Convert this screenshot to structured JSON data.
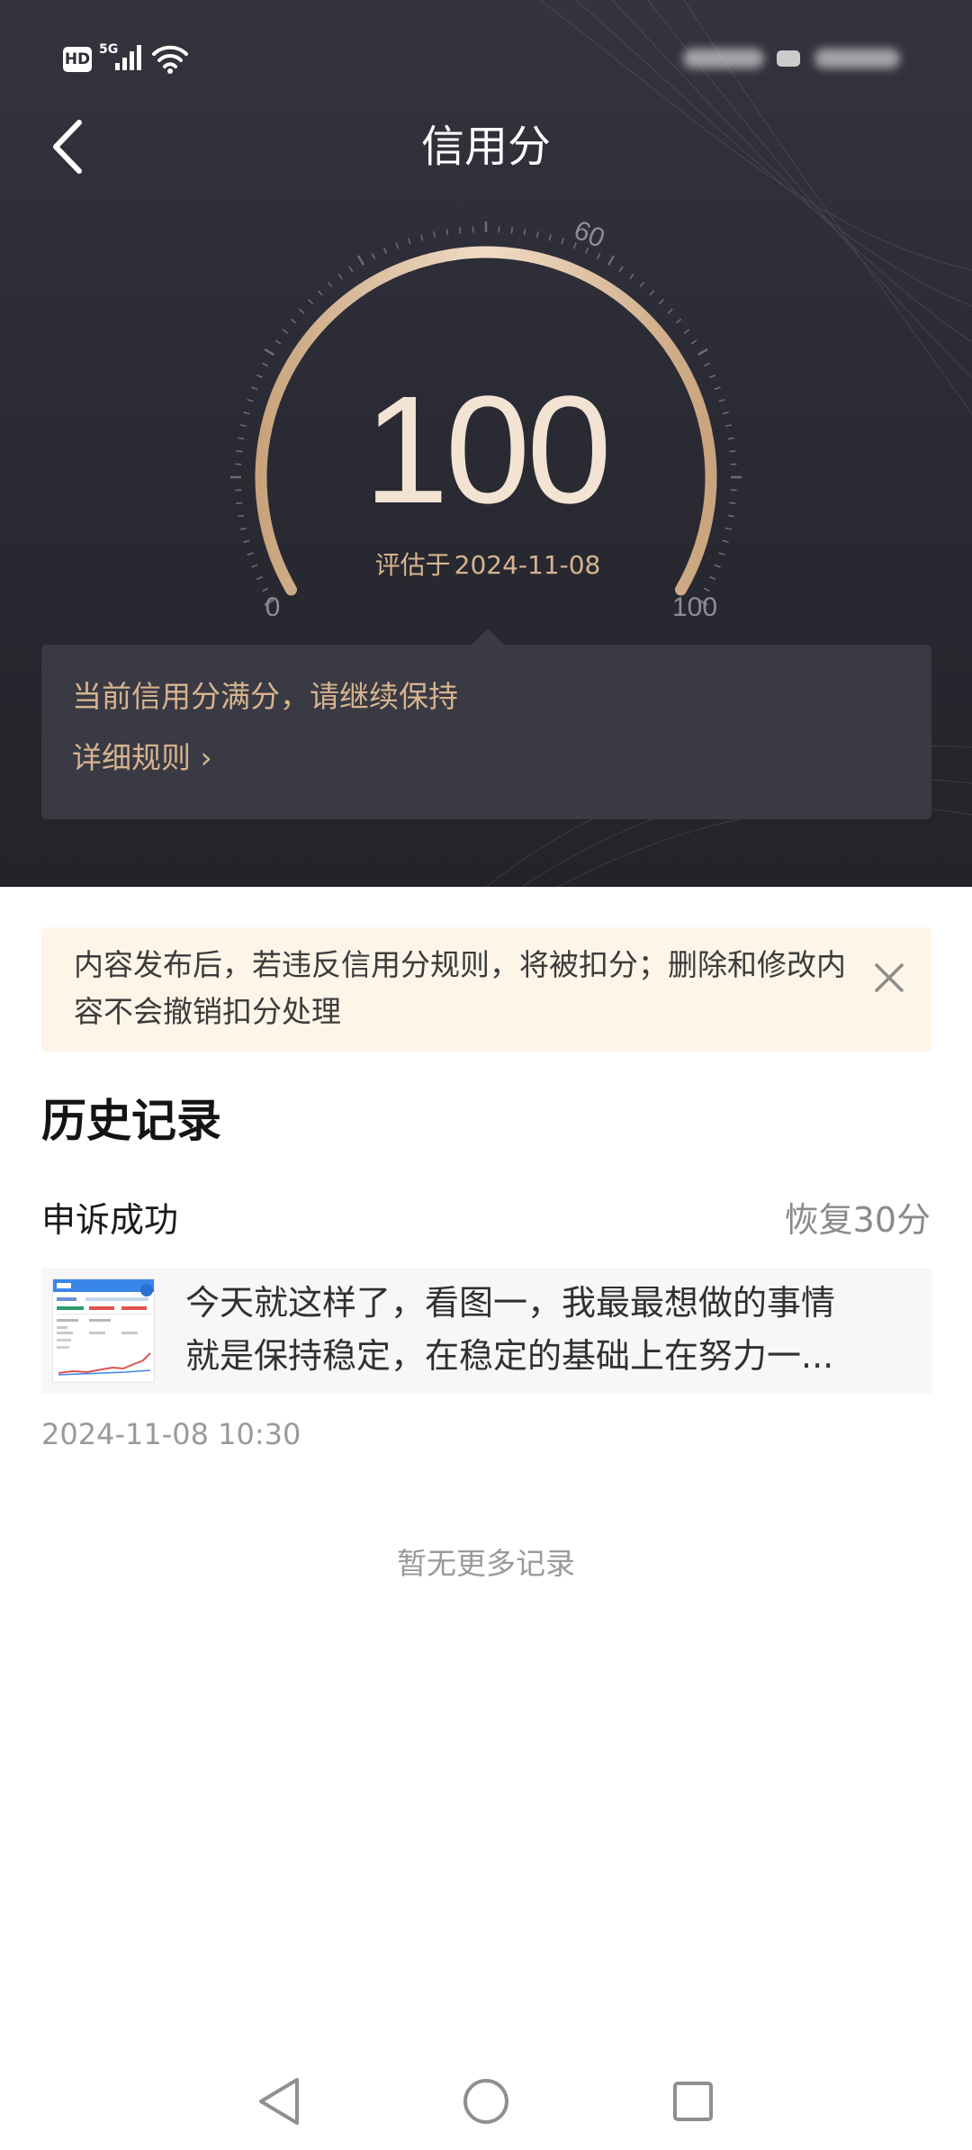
{
  "status_bar": {
    "hd": "HD",
    "network": "5G"
  },
  "header": {
    "title": "信用分"
  },
  "gauge": {
    "score": "100",
    "score_value": 100,
    "min_label": "0",
    "mid_label": "60",
    "max_label": "100",
    "eval_prefix": "评估于",
    "eval_date": "2024-11-08",
    "arc_color": "#e2c3a0"
  },
  "tip": {
    "text": "当前信用分满分，请继续保持",
    "link": "详细规则 ›"
  },
  "notice": {
    "text": "内容发布后，若违反信用分规则，将被扣分；删除和修改内容不会撤销扣分处理"
  },
  "history": {
    "title": "历史记录",
    "records": [
      {
        "title": "申诉成功",
        "points": "恢复30分",
        "line1": "今天就这样了，看图一，我最最想做的事情",
        "line2": "就是保持稳定，在稳定的基础上在努力一...",
        "time": "2024-11-08 10:30"
      }
    ],
    "empty_text": "暂无更多记录"
  },
  "nav": {
    "icons": [
      "back-triangle-icon",
      "home-circle-icon",
      "recent-square-icon"
    ]
  }
}
